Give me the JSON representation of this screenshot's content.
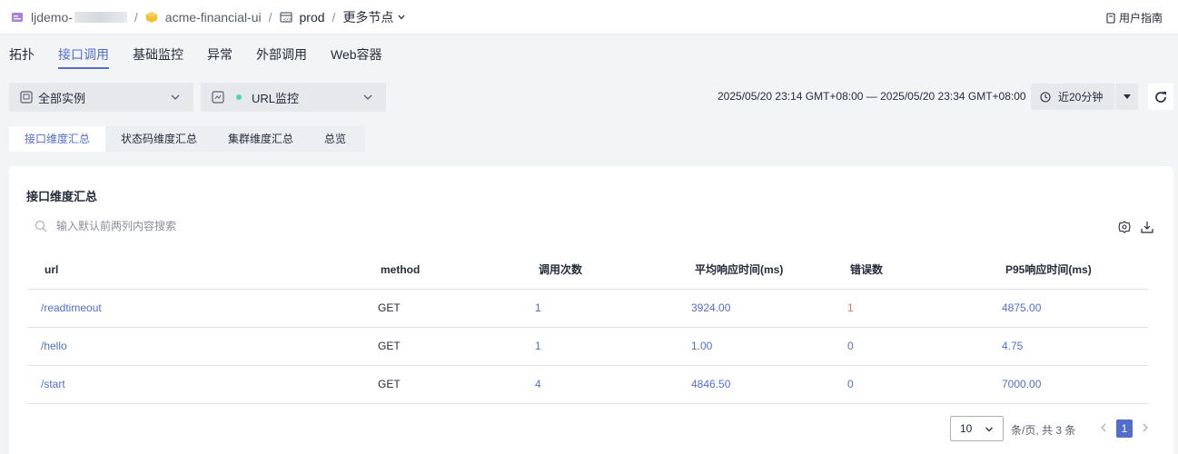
{
  "breadcrumb": {
    "account": "ljdemo-",
    "app": "acme-financial-ui",
    "env": "prod",
    "more": "更多节点"
  },
  "header": {
    "user_guide": "用户指南"
  },
  "tabs": [
    {
      "label": "拓扑",
      "active": false
    },
    {
      "label": "接口调用",
      "active": true
    },
    {
      "label": "基础监控",
      "active": false
    },
    {
      "label": "异常",
      "active": false
    },
    {
      "label": "外部调用",
      "active": false
    },
    {
      "label": "Web容器",
      "active": false
    }
  ],
  "filters": {
    "instance": "全部实例",
    "monitor": "URL监控",
    "time_range": "2025/05/20 23:14 GMT+08:00 — 2025/05/20 23:34 GMT+08:00",
    "quick_range": "近20分钟"
  },
  "subtabs": [
    {
      "label": "接口维度汇总",
      "active": true
    },
    {
      "label": "状态码维度汇总",
      "active": false
    },
    {
      "label": "集群维度汇总",
      "active": false
    },
    {
      "label": "总览",
      "active": false
    }
  ],
  "card": {
    "title": "接口维度汇总",
    "search_placeholder": "输入默认前两列内容搜索"
  },
  "table": {
    "columns": [
      "url",
      "method",
      "调用次数",
      "平均响应时间(ms)",
      "错误数",
      "P95响应时间(ms)"
    ],
    "rows": [
      [
        "/readtimeout",
        "GET",
        "1",
        "3924.00",
        "1",
        "4875.00"
      ],
      [
        "/hello",
        "GET",
        "1",
        "1.00",
        "0",
        "4.75"
      ],
      [
        "/start",
        "GET",
        "4",
        "4846.50",
        "0",
        "7000.00"
      ]
    ]
  },
  "pagination": {
    "page_size": "10",
    "summary": "条/页, 共 3 条",
    "current_page": "1"
  },
  "colors": {
    "accent": "#526ecc",
    "error": "#f66f6a",
    "status_dot": "#50d4ab"
  }
}
